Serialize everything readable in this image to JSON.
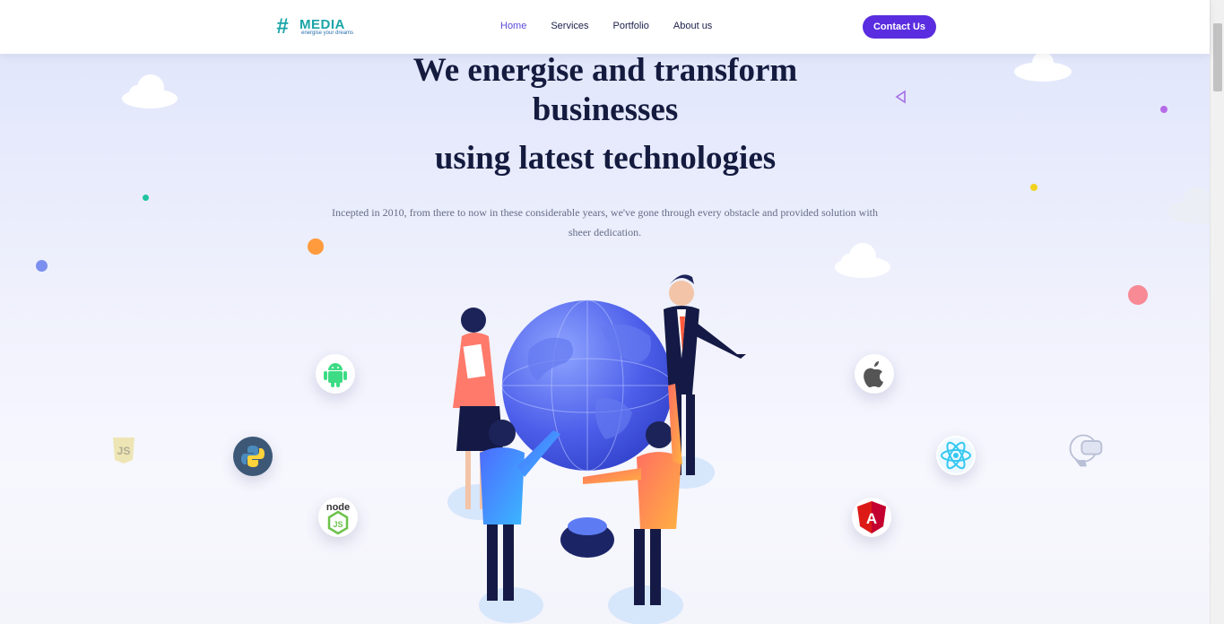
{
  "brand": {
    "logo_word": "MEDIA",
    "tagline": "energise your dreams",
    "teal": "#1aa5a8"
  },
  "nav": {
    "items": [
      {
        "label": "Home",
        "active": true
      },
      {
        "label": "Services",
        "active": false
      },
      {
        "label": "Portfolio",
        "active": false
      },
      {
        "label": "About us",
        "active": false
      }
    ],
    "contact_label": "Contact Us",
    "accent": "#5a2de0"
  },
  "hero": {
    "title_line1": "We energise and transform businesses",
    "title_line2": "using latest technologies",
    "description": "Incepted in 2010, from there to now in these considerable years, we've gone through every obstacle and provided solution with sheer dedication."
  },
  "tech_icons": [
    "android-icon",
    "javascript-icon",
    "python-icon",
    "nodejs-icon",
    "apple-icon",
    "react-icon",
    "angular-icon",
    "vr-headset-icon"
  ]
}
